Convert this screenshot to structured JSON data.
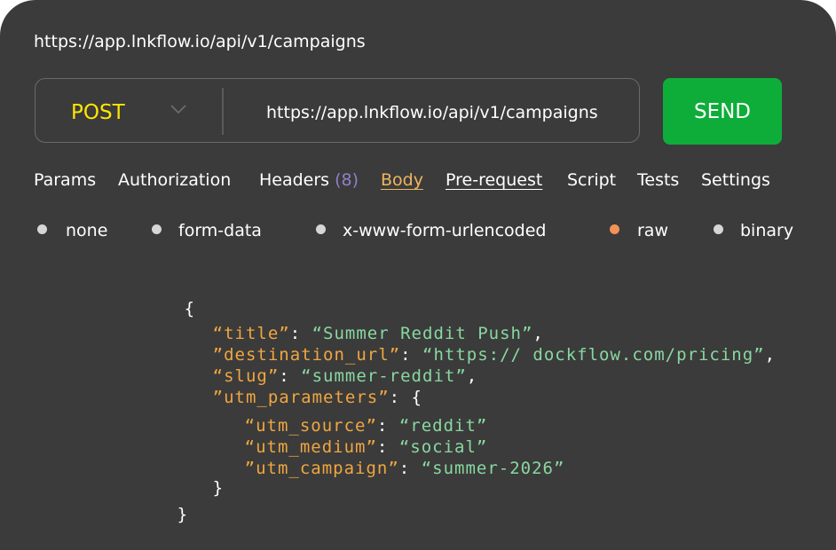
{
  "address_bar": {
    "url": "https://app.lnkflow.io/api/v1/campaigns"
  },
  "request": {
    "method": "POST",
    "url": "https://app.lnkflow.io/api/v1/campaigns",
    "send_label": "SEND"
  },
  "tabs": [
    {
      "label": "Params"
    },
    {
      "label": "Authorization"
    },
    {
      "label": "Headers",
      "count": "(8)"
    },
    {
      "label": "Body",
      "active": true
    },
    {
      "label": "Pre-request"
    },
    {
      "label": "Script"
    },
    {
      "label": "Tests"
    },
    {
      "label": "Settings"
    }
  ],
  "body_types": [
    {
      "label": "none",
      "selected": false
    },
    {
      "label": "form-data",
      "selected": false
    },
    {
      "label": "x-www-form-urlencoded",
      "selected": false
    },
    {
      "label": "raw",
      "selected": true
    },
    {
      "label": "binary",
      "selected": false
    }
  ],
  "code": {
    "open_brace": "{",
    "title_key": "“title”",
    "title_value": "“Summer Reddit Push”",
    "destination_key": "”destination_url”",
    "destination_value": "“https:// dockflow.com/pricing”",
    "slug_key": "“slug”",
    "slug_value": "“summer-reddit”",
    "utm_key": "”utm_parameters”",
    "utm_source_key": "“utm_source”",
    "utm_source_value": "“reddit”",
    "utm_medium_key": "“utm_medium”",
    "utm_medium_value": "“social”",
    "utm_campaign_key": "”utm_campaign”",
    "utm_campaign_value": "“summer-2026”",
    "inner_close": "}",
    "outer_close": "}"
  },
  "colors": {
    "panel_bg": "#3b3b3b",
    "method": "#ffe600",
    "send_bg": "#0ead3a",
    "active_tab": "#f0b45f",
    "count": "#8f80c9",
    "selected_radio": "#f39356",
    "json_key": "#f0a640",
    "json_string": "#88d8a0"
  }
}
